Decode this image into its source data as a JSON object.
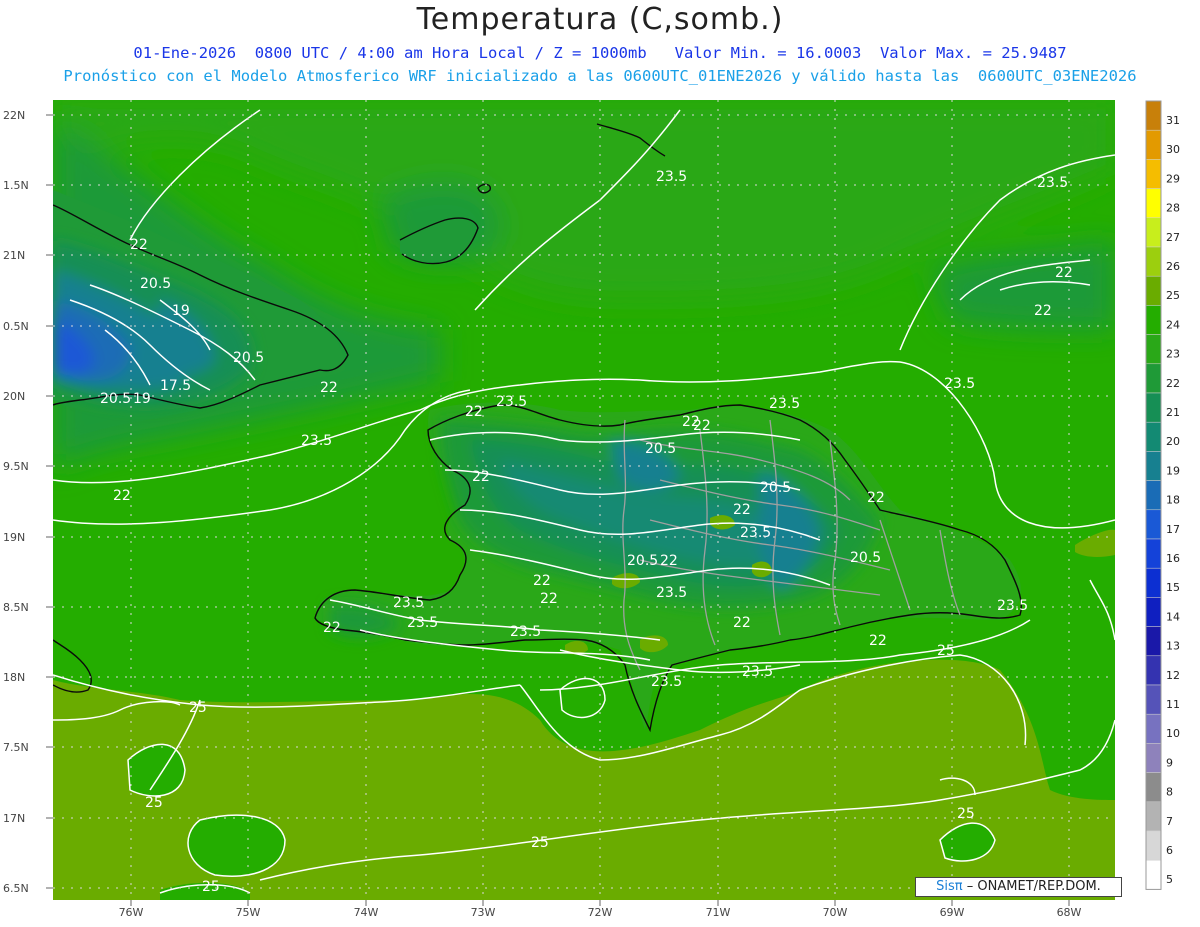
{
  "header": {
    "title": "Temperatura (C,somb.)",
    "line1": "01-Ene-2026  0800 UTC / 4:00 am Hora Local / Z = 1000mb   Valor Min. = 16.0003  Valor Max. = 25.9487",
    "line2": "Pronóstico con el Modelo Atmosferico WRF inicializado a las 0600UTC_01ENE2026 y válido hasta las  0600UTC_03ENE2026"
  },
  "map": {
    "lat_labels": [
      "22N",
      "1.5N",
      "21N",
      "0.5N",
      "20N",
      "9.5N",
      "19N",
      "8.5N",
      "18N",
      "7.5N",
      "17N",
      "6.5N"
    ],
    "lon_labels": [
      "76W",
      "75W",
      "74W",
      "73W",
      "72W",
      "71W",
      "70W",
      "69W",
      "68W"
    ],
    "contour_labels": [
      "23.5",
      "23.5",
      "22",
      "20.5",
      "19",
      "20.5",
      "17.5",
      "20.5",
      "19",
      "22",
      "23.5",
      "22",
      "22",
      "22",
      "23.5",
      "22",
      "22",
      "20.5",
      "20.5",
      "22",
      "22",
      "23.5",
      "20.5",
      "22",
      "20.5",
      "22",
      "22",
      "23.5",
      "22",
      "23.5",
      "23.5",
      "22",
      "23.5",
      "22",
      "23.5",
      "22",
      "25",
      "23.5",
      "23.5",
      "25",
      "25",
      "25",
      "25",
      "25",
      "23.5",
      "22",
      "22",
      "23.5"
    ]
  },
  "colorbar": {
    "labels": [
      "31",
      "30",
      "29",
      "28",
      "27",
      "26",
      "25",
      "24",
      "23",
      "22",
      "21",
      "20",
      "19",
      "18",
      "17",
      "16",
      "15",
      "14",
      "13",
      "12",
      "11",
      "10",
      "9",
      "8",
      "7",
      "6",
      "5"
    ],
    "colors": [
      "#c8800a",
      "#e39a00",
      "#f5bd00",
      "#ffff00",
      "#c8ee1c",
      "#9ccf0e",
      "#6aac00",
      "#24ad00",
      "#2aa818",
      "#1f9a37",
      "#168f55",
      "#138a73",
      "#178090",
      "#1a6cb6",
      "#1a59d6",
      "#1442d9",
      "#0c2fd2",
      "#0f1fc0",
      "#1a18a8",
      "#3433b0",
      "#5553b8",
      "#7772c0",
      "#8e82bb",
      "#8c8c8c",
      "#b3b3b3",
      "#d7d7d7",
      "#ffffff"
    ]
  },
  "credit": {
    "brand": "Sisπ",
    "text": "– ONAMET/REP.DOM."
  }
}
